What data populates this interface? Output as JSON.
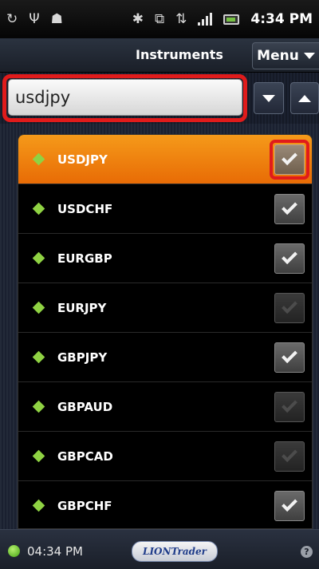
{
  "status_bar": {
    "time": "4:34 PM",
    "icons": [
      "sync-icon",
      "usb-icon",
      "android-debug-icon",
      "bluetooth-icon",
      "vibrate-icon",
      "data-transfer-icon",
      "signal-icon",
      "battery-icon"
    ]
  },
  "title_bar": {
    "title": "Instruments",
    "menu_label": "Menu"
  },
  "search": {
    "value": "usdjpy"
  },
  "instruments": [
    {
      "symbol": "USDJPY",
      "checked": true,
      "selected": true
    },
    {
      "symbol": "USDCHF",
      "checked": true,
      "selected": false
    },
    {
      "symbol": "EURGBP",
      "checked": true,
      "selected": false
    },
    {
      "symbol": "EURJPY",
      "checked": false,
      "selected": false
    },
    {
      "symbol": "GBPJPY",
      "checked": true,
      "selected": false
    },
    {
      "symbol": "GBPAUD",
      "checked": false,
      "selected": false
    },
    {
      "symbol": "GBPCAD",
      "checked": false,
      "selected": false
    },
    {
      "symbol": "GBPCHF",
      "checked": true,
      "selected": false
    }
  ],
  "bottom_bar": {
    "time": "04:34 PM",
    "logo_text": "LIONTrader"
  },
  "colors": {
    "highlight": "#e01b1b",
    "selected_row": "#f28a12",
    "diamond": "#8fd243"
  }
}
